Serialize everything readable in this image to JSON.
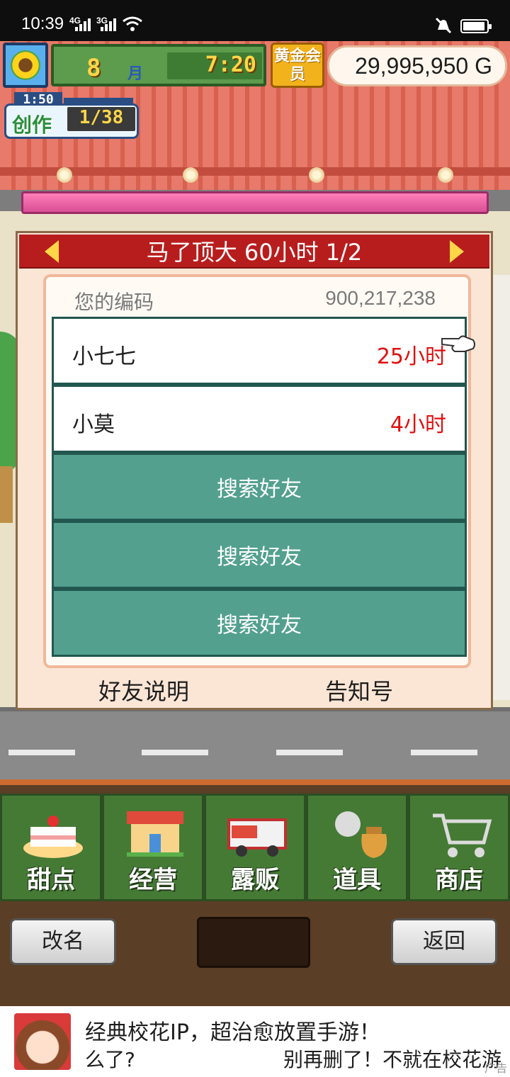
{
  "status_bar": {
    "time": "10:39",
    "sim1": "4G",
    "sim2": "3G",
    "icons": [
      "signal-icon",
      "wifi-icon",
      "mute-icon",
      "battery-icon"
    ]
  },
  "hud": {
    "month": "8",
    "month_label": "月",
    "clock": "7:20",
    "gold_member": "黄金会员",
    "money": "29,995,950 G",
    "create_label": "创作",
    "create_count": "1/38",
    "create_timer": "1:50"
  },
  "dialog": {
    "title": "马了顶大  60小时 1/2",
    "code_label": "您的编码",
    "code_value": "900,217,238",
    "friends": [
      {
        "name": "小七七",
        "time": "25小时"
      },
      {
        "name": "小莫",
        "time": "4小时"
      }
    ],
    "search_label": "搜索好友",
    "footer_left": "好友说明",
    "footer_right": "告知号"
  },
  "menu": {
    "items": [
      {
        "label": "甜点",
        "icon": "cake-icon"
      },
      {
        "label": "经营",
        "icon": "shop-icon"
      },
      {
        "label": "露贩",
        "icon": "food-truck-icon"
      },
      {
        "label": "道具",
        "icon": "item-bag-icon"
      },
      {
        "label": "商店",
        "icon": "cart-icon"
      }
    ],
    "rename": "改名",
    "back": "返回"
  },
  "ad": {
    "title": "经典校花IP，超治愈放置手游！",
    "sub_left": "么了?",
    "sub_right": "别再删了！不就在校花游",
    "tag": "广告"
  },
  "colors": {
    "header_red": "#b81d1d",
    "row_teal": "#53a08f",
    "time_red": "#e01010",
    "menu_green": "#457a35"
  }
}
